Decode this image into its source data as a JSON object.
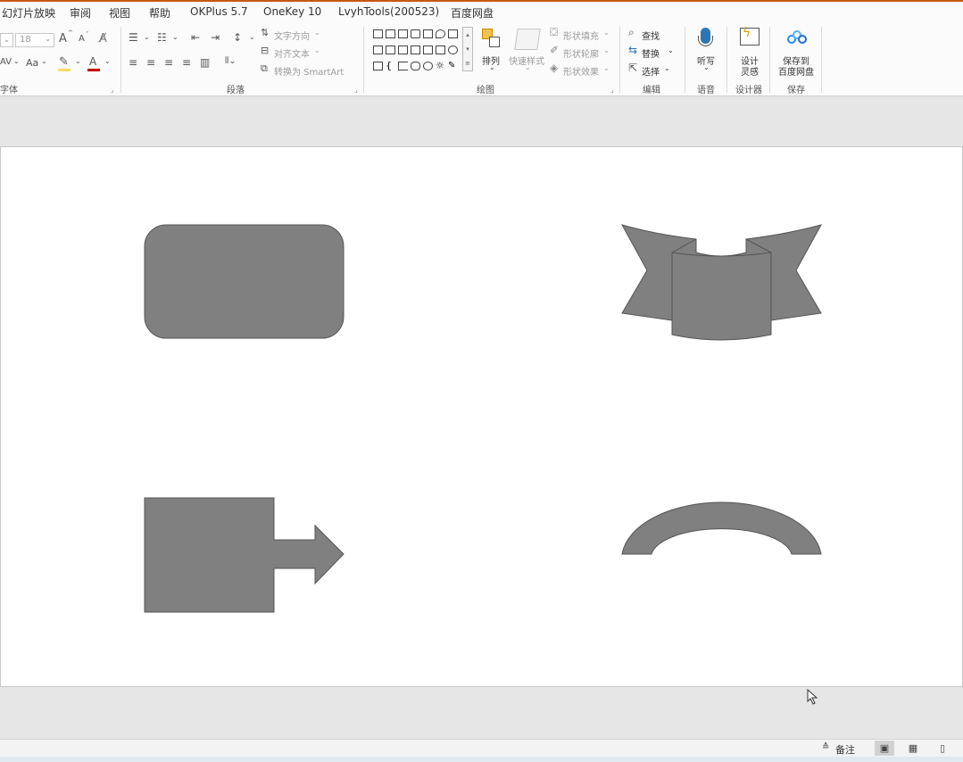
{
  "menu": {
    "items": [
      "幻灯片放映",
      "审阅",
      "视图",
      "帮助",
      "OKPlus 5.7",
      "OneKey 10",
      "LvyhTools(200523)",
      "百度网盘"
    ]
  },
  "ribbon": {
    "font": {
      "label": "字体",
      "size_value": "18",
      "grow_font": "A",
      "shrink_font": "A",
      "case_label": "Aa",
      "spacing_label": "AV"
    },
    "paragraph": {
      "label": "段落",
      "text_direction": "文字方向",
      "align_text": "对齐文本",
      "convert_smartart": "转换为 SmartArt"
    },
    "drawing": {
      "label": "绘图",
      "arrange": "排列",
      "quick_styles": "快速样式",
      "shape_fill": "形状填充",
      "shape_outline": "形状轮廓",
      "shape_effects": "形状效果"
    },
    "editing": {
      "label": "编辑",
      "find": "查找",
      "replace": "替换",
      "select": "选择"
    },
    "voice": {
      "label": "语音",
      "dictate": "听写"
    },
    "designer": {
      "label": "设计器",
      "design_ideas_line1": "设计",
      "design_ideas_line2": "灵感"
    },
    "save": {
      "label": "保存",
      "save_to_line1": "保存到",
      "save_to_line2": "百度网盘"
    }
  },
  "slide": {
    "shape_fill": "#808080",
    "shape_stroke": "#555555"
  },
  "status": {
    "notes": "备注"
  },
  "colors": {
    "accent": "#c55a11",
    "mic": "#2e75b6",
    "baidu_blue": "#2b8ce6"
  }
}
